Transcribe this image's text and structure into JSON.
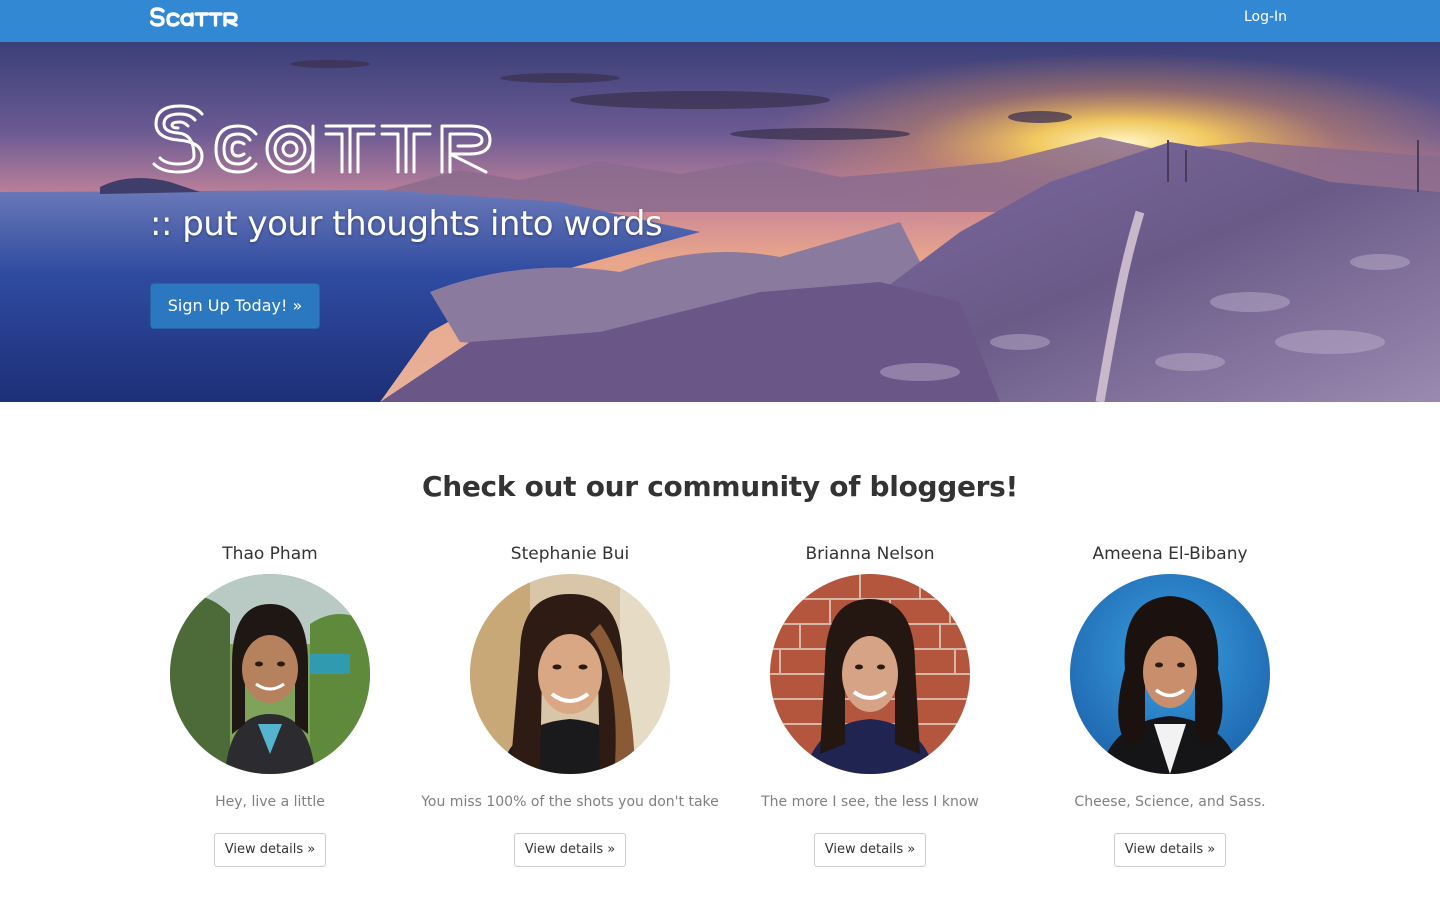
{
  "navbar": {
    "brand": "Scattr",
    "login_label": "Log-In",
    "color": "#3288d2"
  },
  "hero": {
    "logo": "Scattr",
    "tagline": ":: put your thoughts into words",
    "signup_label": "Sign Up Today! »",
    "background": "coastal-mountain-sunset-photo"
  },
  "community": {
    "title": "Check out our community of bloggers!",
    "bloggers": [
      {
        "name": "Thao Pham",
        "bio": "Hey, live a little",
        "button_label": "View details »"
      },
      {
        "name": "Stephanie Bui",
        "bio": "You miss 100% of the shots you don't take",
        "button_label": "View details »"
      },
      {
        "name": "Brianna Nelson",
        "bio": "The more I see, the less I know",
        "button_label": "View details »"
      },
      {
        "name": "Ameena El-Bibany",
        "bio": "Cheese, Science, and Sass.",
        "button_label": "View details »"
      }
    ]
  }
}
